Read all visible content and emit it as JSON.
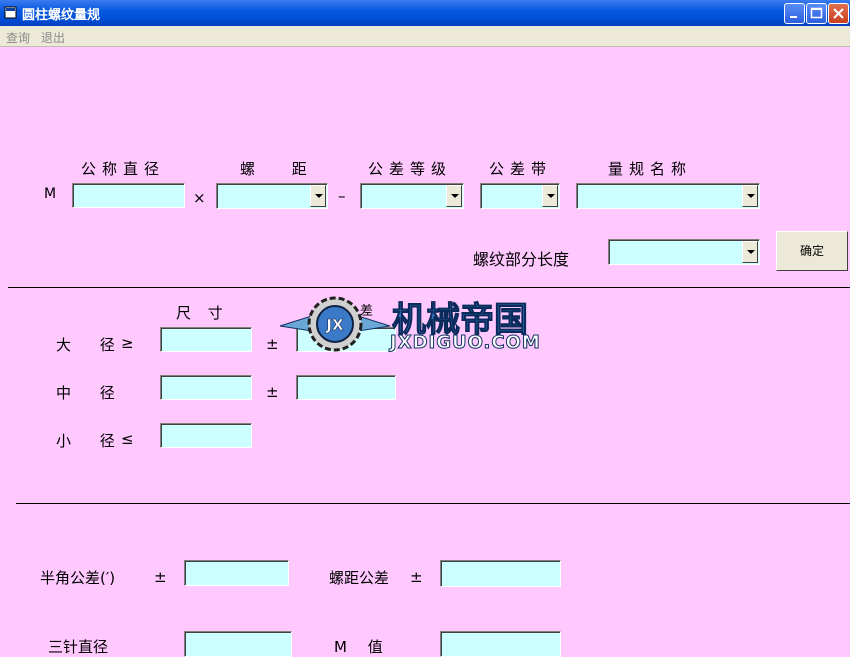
{
  "window": {
    "title": "圆柱螺纹量规"
  },
  "menu": {
    "items": [
      {
        "label": "查询"
      },
      {
        "label": "退出"
      }
    ]
  },
  "spec": {
    "labels": {
      "nominal_diameter": "公称直径",
      "pitch": "螺 距",
      "tolerance_grade": "公差等级",
      "tolerance_zone": "公差带",
      "gauge_name": "量规名称",
      "m_prefix": "M",
      "times": "×",
      "dash": "–",
      "thread_length": "螺纹部分长度"
    },
    "fields": {
      "nominal_diameter": "",
      "pitch": "",
      "tolerance_grade": "",
      "tolerance_zone": "",
      "gauge_name": "",
      "thread_length": ""
    },
    "confirm_label": "确定"
  },
  "dims": {
    "size_header": "尺 寸",
    "tol_header": "差",
    "major": {
      "label": "大 径",
      "sign": "≥",
      "pm": "±"
    },
    "pitch_dia": {
      "label": "中 径",
      "pm": "±"
    },
    "minor": {
      "label": "小 径",
      "sign": "≤"
    }
  },
  "bottom": {
    "half_angle_label": "半角公差(′)",
    "half_angle_pm": "±",
    "pitch_tol_label": "螺距公差",
    "pitch_tol_pm": "±",
    "three_wire_label": "三针直径",
    "m_value_label": "M 值"
  },
  "watermark": {
    "brand": "机械帝国",
    "url": "JXDIGUO.COM",
    "logo": "JX"
  },
  "colors": {
    "background": "#ffc8ff",
    "field": "#ccffff",
    "titlebar": "#0050d8"
  }
}
